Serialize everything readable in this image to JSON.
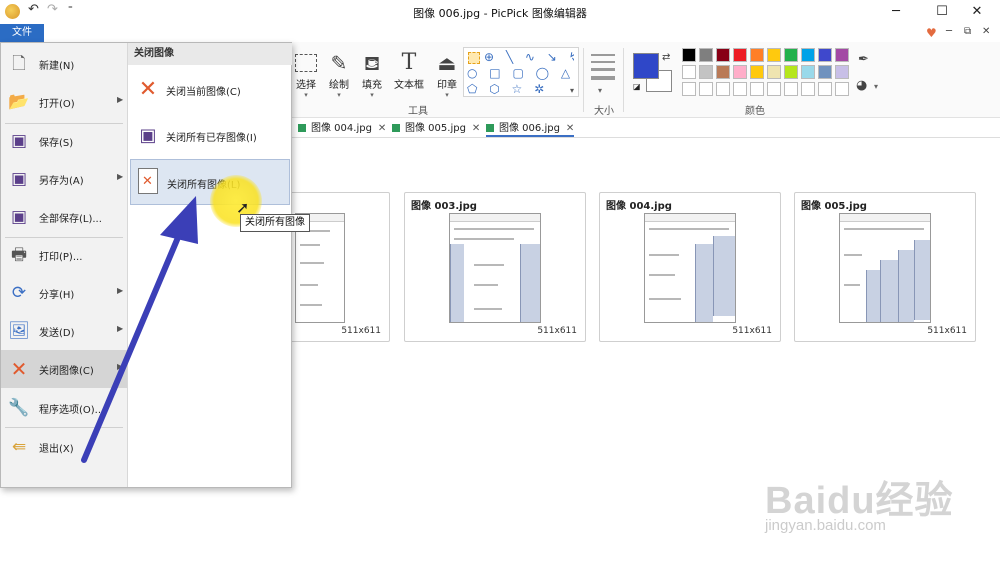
{
  "window": {
    "title": "图像 006.jpg - PicPick 图像编辑器",
    "minimize": "─",
    "maximize": "☐",
    "close": "✕"
  },
  "quick_access": {
    "undo": "↶",
    "redo": "↷",
    "more": "⁼"
  },
  "menubar": {
    "file_tab": "文件",
    "heart": "♥",
    "restore": "⧉",
    "mini_close": "✕",
    "help": "❓"
  },
  "ribbon": {
    "select": "选择",
    "draw": "绘制",
    "fill": "填充",
    "text": "文本框",
    "stamp": "印章",
    "tools_group": "工具",
    "size_group": "大小",
    "colors_group": "颜色",
    "text_icon": "T"
  },
  "palette_colors": [
    [
      "#000000",
      "#7f7f7f",
      "#880015",
      "#ed1c24",
      "#ff7f27",
      "#ffc90e",
      "#22b14c",
      "#00a2e8",
      "#3f48cc",
      "#a349a4"
    ],
    [
      "#ffffff",
      "#c3c3c3",
      "#b97a57",
      "#ffaec9",
      "#ffc90e",
      "#efe4b0",
      "#b5e61d",
      "#99d9ea",
      "#7092be",
      "#c8bfe7"
    ],
    [
      "#ffffff",
      "#ffffff",
      "#ffffff",
      "#ffffff",
      "#ffffff",
      "#ffffff",
      "#ffffff",
      "#ffffff",
      "#ffffff",
      "#ffffff"
    ]
  ],
  "tabs": [
    {
      "label": "图像 004.jpg",
      "close": "✕"
    },
    {
      "label": "图像 005.jpg",
      "close": "✕"
    },
    {
      "label": "图像 006.jpg",
      "close": "✕"
    }
  ],
  "thumbnails": [
    {
      "name": "",
      "size": "511x611"
    },
    {
      "name": "图像 003.jpg",
      "size": "511x611"
    },
    {
      "name": "图像 004.jpg",
      "size": "511x611"
    },
    {
      "name": "图像 005.jpg",
      "size": "511x611"
    }
  ],
  "bottom_thumb_size": "511x611",
  "file_menu": {
    "items": [
      {
        "label": "新建(N)",
        "icon": "new-file-icon"
      },
      {
        "label": "打开(O)",
        "icon": "open-folder-icon",
        "arrow": "▶"
      },
      {
        "label": "保存(S)",
        "icon": "save-icon"
      },
      {
        "label": "另存为(A)",
        "icon": "save-as-icon",
        "arrow": "▶"
      },
      {
        "label": "全部保存(L)...",
        "icon": "save-all-icon"
      },
      {
        "label": "打印(P)...",
        "icon": "print-icon"
      },
      {
        "label": "分享(H)",
        "icon": "share-icon",
        "arrow": "▶"
      },
      {
        "label": "发送(D)",
        "icon": "send-icon",
        "arrow": "▶"
      },
      {
        "label": "关闭图像(C)",
        "icon": "close-image-icon",
        "arrow": "▶"
      },
      {
        "label": "程序选项(O)...",
        "icon": "options-icon"
      },
      {
        "label": "退出(X)",
        "icon": "exit-icon"
      }
    ],
    "submenu_title": "关闭图像",
    "submenu": [
      {
        "label": "关闭当前图像(C)"
      },
      {
        "label": "关闭所有已存图像(I)"
      },
      {
        "label": "关闭所有图像(L)"
      }
    ]
  },
  "tooltip": "关闭所有图像",
  "watermark": {
    "brand": "Baidu经验",
    "url": "jingyan.baidu.com"
  },
  "accent_colors": {
    "primary": "#2f47c8",
    "file_tab": "#2b6cc4",
    "arrow": "#3b3fb7",
    "highlight": "#f7e32a"
  }
}
